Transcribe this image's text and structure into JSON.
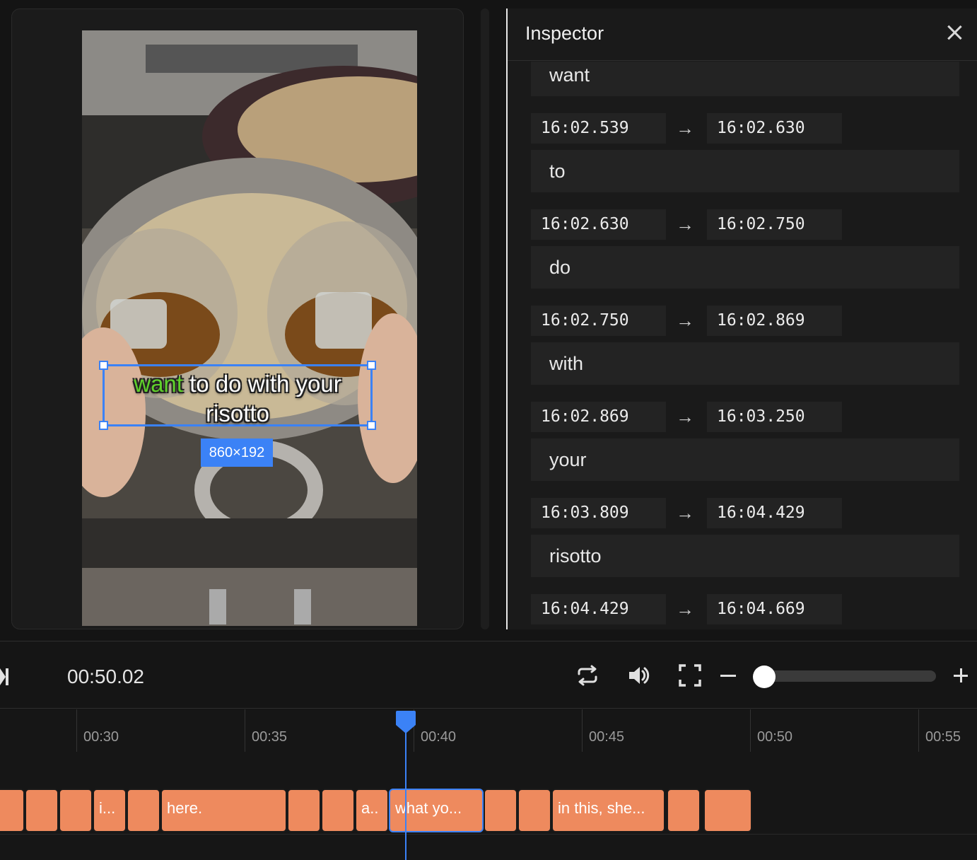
{
  "preview": {
    "caption": {
      "highlight_word": "want",
      "line1_rest": " to do with your",
      "line2": "risotto"
    },
    "size_badge": "860×192"
  },
  "inspector": {
    "title": "Inspector",
    "segments": [
      {
        "start": "",
        "end": "",
        "word": "want"
      },
      {
        "start": "16:02.539",
        "end": "16:02.630",
        "word": "to"
      },
      {
        "start": "16:02.630",
        "end": "16:02.750",
        "word": "do"
      },
      {
        "start": "16:02.750",
        "end": "16:02.869",
        "word": "with"
      },
      {
        "start": "16:02.869",
        "end": "16:03.250",
        "word": "your"
      },
      {
        "start": "16:03.809",
        "end": "16:04.429",
        "word": "risotto"
      },
      {
        "start": "16:04.429",
        "end": "16:04.669",
        "word": ""
      }
    ],
    "arrow": "→"
  },
  "player": {
    "timecode": "00:50.02",
    "icons": [
      "skip-end-icon",
      "loop-icon",
      "volume-icon",
      "fullscreen-icon",
      "zoom-out-icon",
      "zoom-in-icon"
    ],
    "zoom_level": 0.0
  },
  "timeline": {
    "ticks": [
      "00:30",
      "00:35",
      "00:40",
      "00:45",
      "00:50",
      "00:55"
    ],
    "clips": [
      "",
      "",
      "",
      "i...",
      "",
      "here.",
      "",
      "",
      "a..",
      "what yo...",
      "",
      "",
      "in this, she...",
      "",
      ""
    ],
    "selected_clip": "what yo..."
  },
  "colors": {
    "accent": "#3b82f6",
    "clip": "#ee8a5e",
    "highlight": "#5fd12b"
  }
}
